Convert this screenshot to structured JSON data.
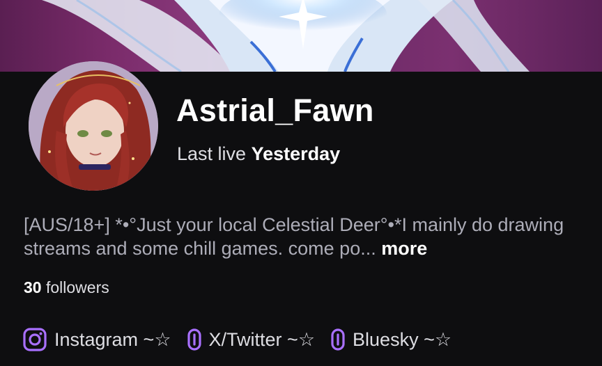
{
  "profile": {
    "display_name": "Astrial_Fawn",
    "last_live_label": "Last live",
    "last_live_value": "Yesterday",
    "bio_text": "[AUS/18+] *•°Just your local Celestial Deer°•*I mainly do drawing streams and some chill games. come po...",
    "more_label": "more",
    "followers_count": "30",
    "followers_label": "followers"
  },
  "social_links": [
    {
      "icon": "instagram-icon",
      "label": "Instagram ~☆"
    },
    {
      "icon": "link-icon",
      "label": "X/Twitter ~☆"
    },
    {
      "icon": "link-icon",
      "label": "Bluesky ~☆"
    }
  ],
  "colors": {
    "background": "#0e0e10",
    "accent": "#a970ff",
    "banner": "#7a2b6a",
    "text_primary": "#ffffff",
    "text_muted": "#adadb8"
  }
}
